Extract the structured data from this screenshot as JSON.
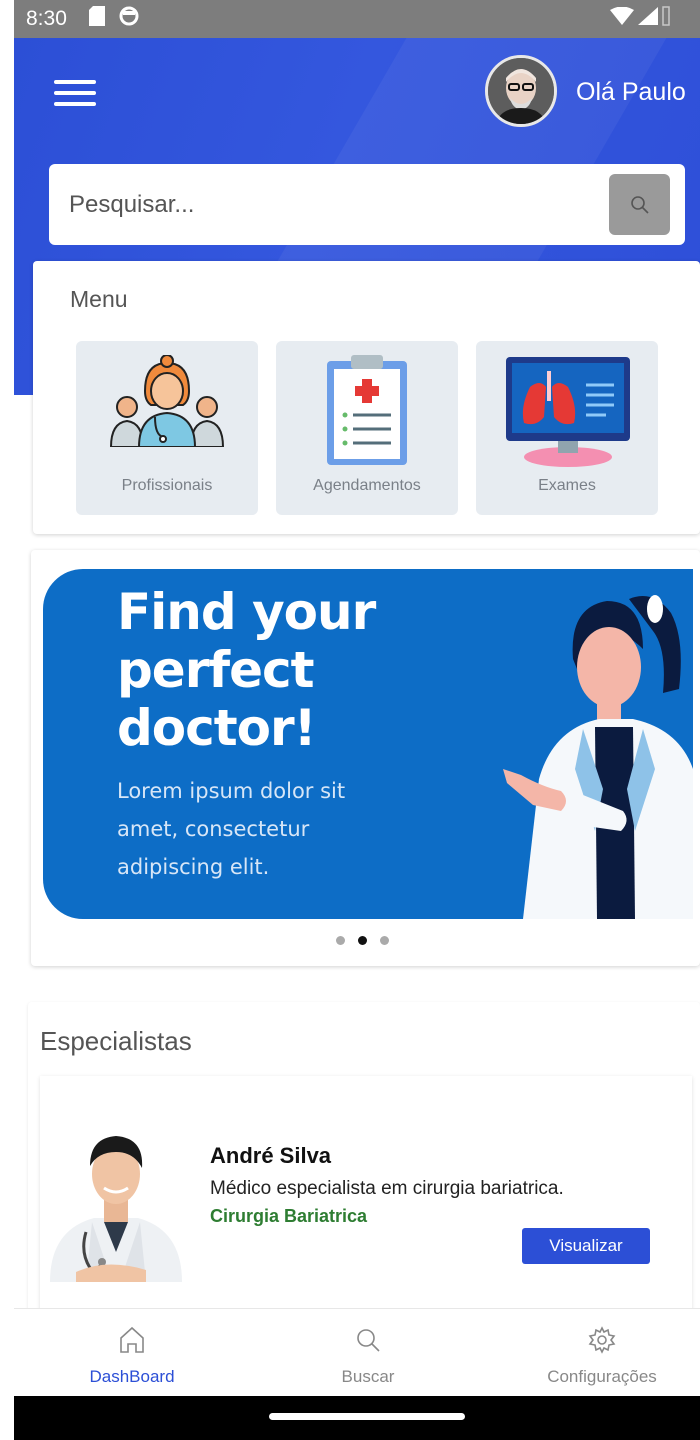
{
  "status_bar": {
    "time": "8:30"
  },
  "header": {
    "greeting": "Olá Paulo",
    "search_placeholder": "Pesquisar...",
    "brand_color": "#2c4fd6"
  },
  "menu": {
    "title": "Menu",
    "items": [
      {
        "label": "Profissionais",
        "icon": "doctors-group-icon"
      },
      {
        "label": "Agendamentos",
        "icon": "clipboard-icon"
      },
      {
        "label": "Exames",
        "icon": "lungs-monitor-icon"
      }
    ]
  },
  "banner": {
    "title": "Find your perfect doctor!",
    "text": "Lorem ipsum dolor sit amet, consectetur adipiscing elit.",
    "slides_total": 3,
    "active_slide": 2
  },
  "specialists": {
    "title": "Especialistas",
    "items": [
      {
        "name": "André Silva",
        "description": "Médico especialista em cirurgia bariatrica.",
        "specialty": "Cirurgia Bariatrica",
        "button": "Visualizar"
      }
    ]
  },
  "bottom_nav": [
    {
      "label": "DashBoard",
      "icon": "home-icon",
      "active": true
    },
    {
      "label": "Buscar",
      "icon": "search-icon",
      "active": false
    },
    {
      "label": "Configurações",
      "icon": "gear-icon",
      "active": false
    }
  ]
}
